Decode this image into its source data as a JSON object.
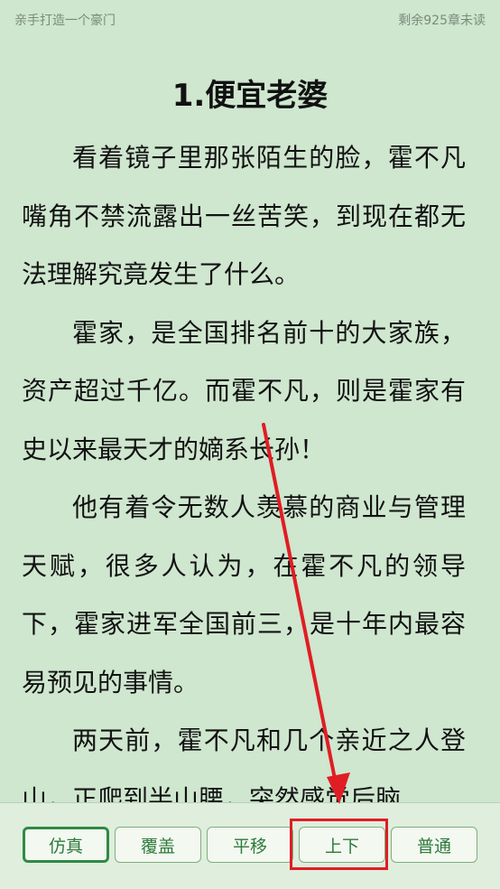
{
  "status": {
    "book_name": "亲手打造一个豪门",
    "remaining": "剩余925章未读"
  },
  "chapter": {
    "title": "1.便宜老婆",
    "paragraphs": [
      "看着镜子里那张陌生的脸，霍不凡嘴角不禁流露出一丝苦笑，到现在都无法理解究竟发生了什么。",
      "霍家，是全国排名前十的大家族，资产超过千亿。而霍不凡，则是霍家有史以来最天才的嫡系长孙！",
      "他有着令无数人羡慕的商业与管理天赋，很多人认为，在霍不凡的领导下，霍家进军全国前三，是十年内最容易预见的事情。",
      "两天前，霍不凡和几个亲近之人登山，正爬到半山腰，突然感觉后脑"
    ]
  },
  "page_modes": {
    "buttons": [
      {
        "label": "仿真",
        "active": true
      },
      {
        "label": "覆盖",
        "active": false
      },
      {
        "label": "平移",
        "active": false
      },
      {
        "label": "上下",
        "active": false
      },
      {
        "label": "普通",
        "active": false
      }
    ]
  },
  "colors": {
    "background": "#cfe6cf",
    "accent": "#2f8a45",
    "annotation": "#e01d24"
  }
}
